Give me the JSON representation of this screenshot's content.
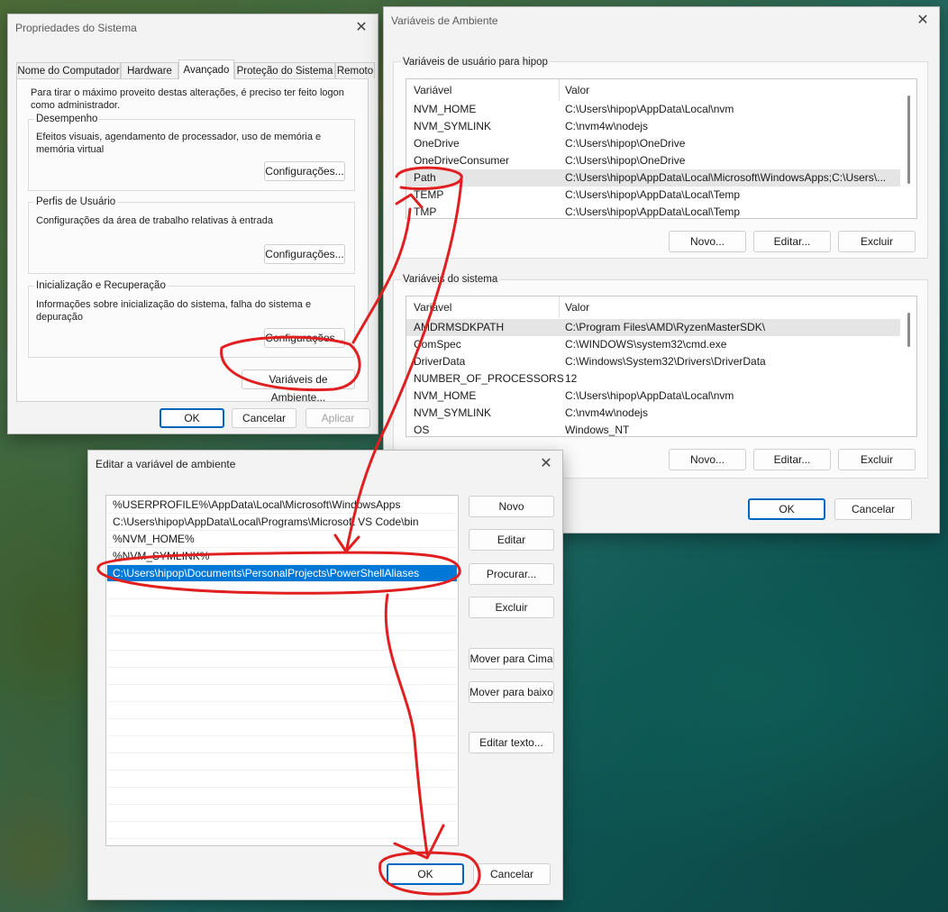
{
  "system_properties": {
    "title": "Propriedades do Sistema",
    "tabs": [
      "Nome do Computador",
      "Hardware",
      "Avançado",
      "Proteção do Sistema",
      "Remoto"
    ],
    "active_tab": "Avançado",
    "intro": "Para tirar o máximo proveito destas alterações, é preciso ter feito logon como administrador.",
    "groups": [
      {
        "title": "Desempenho",
        "text": "Efeitos visuais, agendamento de processador, uso de memória e memória virtual",
        "button": "Configurações..."
      },
      {
        "title": "Perfis de Usuário",
        "text": "Configurações da área de trabalho relativas à entrada",
        "button": "Configurações..."
      },
      {
        "title": "Inicialização e Recuperação",
        "text": "Informações sobre inicialização do sistema, falha do sistema e depuração",
        "button": "Configurações..."
      }
    ],
    "env_button": "Variáveis de Ambiente...",
    "ok": "OK",
    "cancel": "Cancelar",
    "apply": "Aplicar"
  },
  "env_vars": {
    "title": "Variáveis de Ambiente",
    "user_group_title": "Variáveis de usuário para hipop",
    "col_variable": "Variável",
    "col_value": "Valor",
    "user_vars": [
      {
        "name": "NVM_HOME",
        "value": "C:\\Users\\hipop\\AppData\\Local\\nvm"
      },
      {
        "name": "NVM_SYMLINK",
        "value": "C:\\nvm4w\\nodejs"
      },
      {
        "name": "OneDrive",
        "value": "C:\\Users\\hipop\\OneDrive"
      },
      {
        "name": "OneDriveConsumer",
        "value": "C:\\Users\\hipop\\OneDrive"
      },
      {
        "name": "Path",
        "value": "C:\\Users\\hipop\\AppData\\Local\\Microsoft\\WindowsApps;C:\\Users\\..."
      },
      {
        "name": "TEMP",
        "value": "C:\\Users\\hipop\\AppData\\Local\\Temp"
      },
      {
        "name": "TMP",
        "value": "C:\\Users\\hipop\\AppData\\Local\\Temp"
      }
    ],
    "system_group_title": "Variáveis do sistema",
    "system_vars": [
      {
        "name": "AMDRMSDKPATH",
        "value": "C:\\Program Files\\AMD\\RyzenMasterSDK\\"
      },
      {
        "name": "ComSpec",
        "value": "C:\\WINDOWS\\system32\\cmd.exe"
      },
      {
        "name": "DriverData",
        "value": "C:\\Windows\\System32\\Drivers\\DriverData"
      },
      {
        "name": "NUMBER_OF_PROCESSORS",
        "value": "12"
      },
      {
        "name": "NVM_HOME",
        "value": "C:\\Users\\hipop\\AppData\\Local\\nvm"
      },
      {
        "name": "NVM_SYMLINK",
        "value": "C:\\nvm4w\\nodejs"
      },
      {
        "name": "OS",
        "value": "Windows_NT"
      }
    ],
    "new": "Novo...",
    "edit": "Editar...",
    "delete": "Excluir",
    "ok": "OK",
    "cancel": "Cancelar"
  },
  "edit_var": {
    "title": "Editar a variável de ambiente",
    "entries": [
      "%USERPROFILE%\\AppData\\Local\\Microsoft\\WindowsApps",
      "C:\\Users\\hipop\\AppData\\Local\\Programs\\Microsoft VS Code\\bin",
      "%NVM_HOME%",
      "%NVM_SYMLINK%",
      "C:\\Users\\hipop\\Documents\\PersonalProjects\\PowerShellAliases"
    ],
    "buttons": {
      "new": "Novo",
      "edit": "Editar",
      "browse": "Procurar...",
      "delete": "Excluir",
      "move_up": "Mover para Cima",
      "move_down": "Mover para baixo",
      "edit_text": "Editar texto...",
      "ok": "OK",
      "cancel": "Cancelar"
    }
  },
  "colors": {
    "selection": "#0078d7",
    "annotation": "#e02020",
    "primary_border": "#0067c0"
  }
}
